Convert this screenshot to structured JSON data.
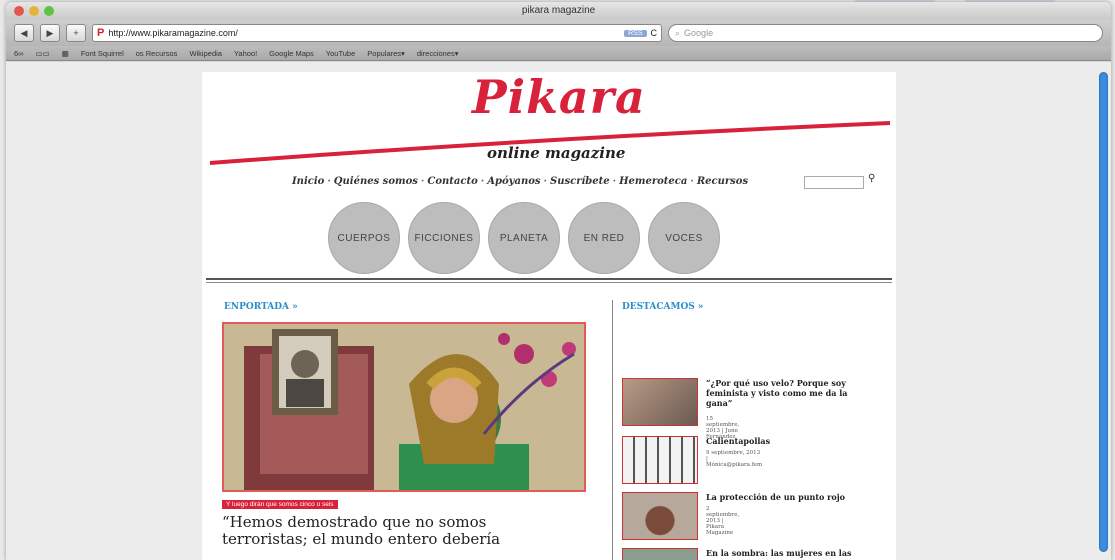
{
  "window": {
    "title": "pikara magazine"
  },
  "toolbar": {
    "back_label": "◀",
    "forward_label": "▶",
    "add_label": "+",
    "url": "http://www.pikaramagazine.com/",
    "rss_label": "RSS",
    "reload_label": "C",
    "search_placeholder": "Google"
  },
  "bookmarks": [
    "Font Squirrel",
    "os Recursos",
    "Wikipedia",
    "Yahoo!",
    "Google Maps",
    "YouTube",
    "Populares▾",
    "direcciones▾"
  ],
  "site": {
    "logo": "Pikara",
    "subtitle": "online magazine",
    "menu": [
      "Inicio",
      "Quiénes somos",
      "Contacto",
      "Apóyanos",
      "Suscríbete",
      "Hemeroteca",
      "Recursos"
    ],
    "menu_sep": "·",
    "categories": [
      "CUERPOS",
      "FICCIONES",
      "PLANETA",
      "EN RED",
      "VOCES"
    ],
    "portada_head": "ENPORTADA »",
    "destacamos_head": "DESTACAMOS »",
    "feature_tag": "Y luego dirán que somos cinco o seis",
    "headline": "“Hemos demostrado que no somos terroristas; el mundo entero debería"
  },
  "destacamos": [
    {
      "title": "“¿Por qué uso velo? Porque soy feminista y visto como me da la gana”",
      "meta": "15 septiembre, 2013 | June Fernández"
    },
    {
      "title": "Calientapollas",
      "meta": "9 septiembre, 2013 | Mónica@pikara.fem"
    },
    {
      "title": "La protección de un punto rojo",
      "meta": "2 septiembre, 2013 | Pikara Magazine"
    },
    {
      "title": "En la sombra: las mujeres en las"
    }
  ],
  "colors": {
    "brand_red": "#d8213a",
    "accent_blue": "#2a8fc9",
    "scrollbar": "#3b8be0"
  }
}
